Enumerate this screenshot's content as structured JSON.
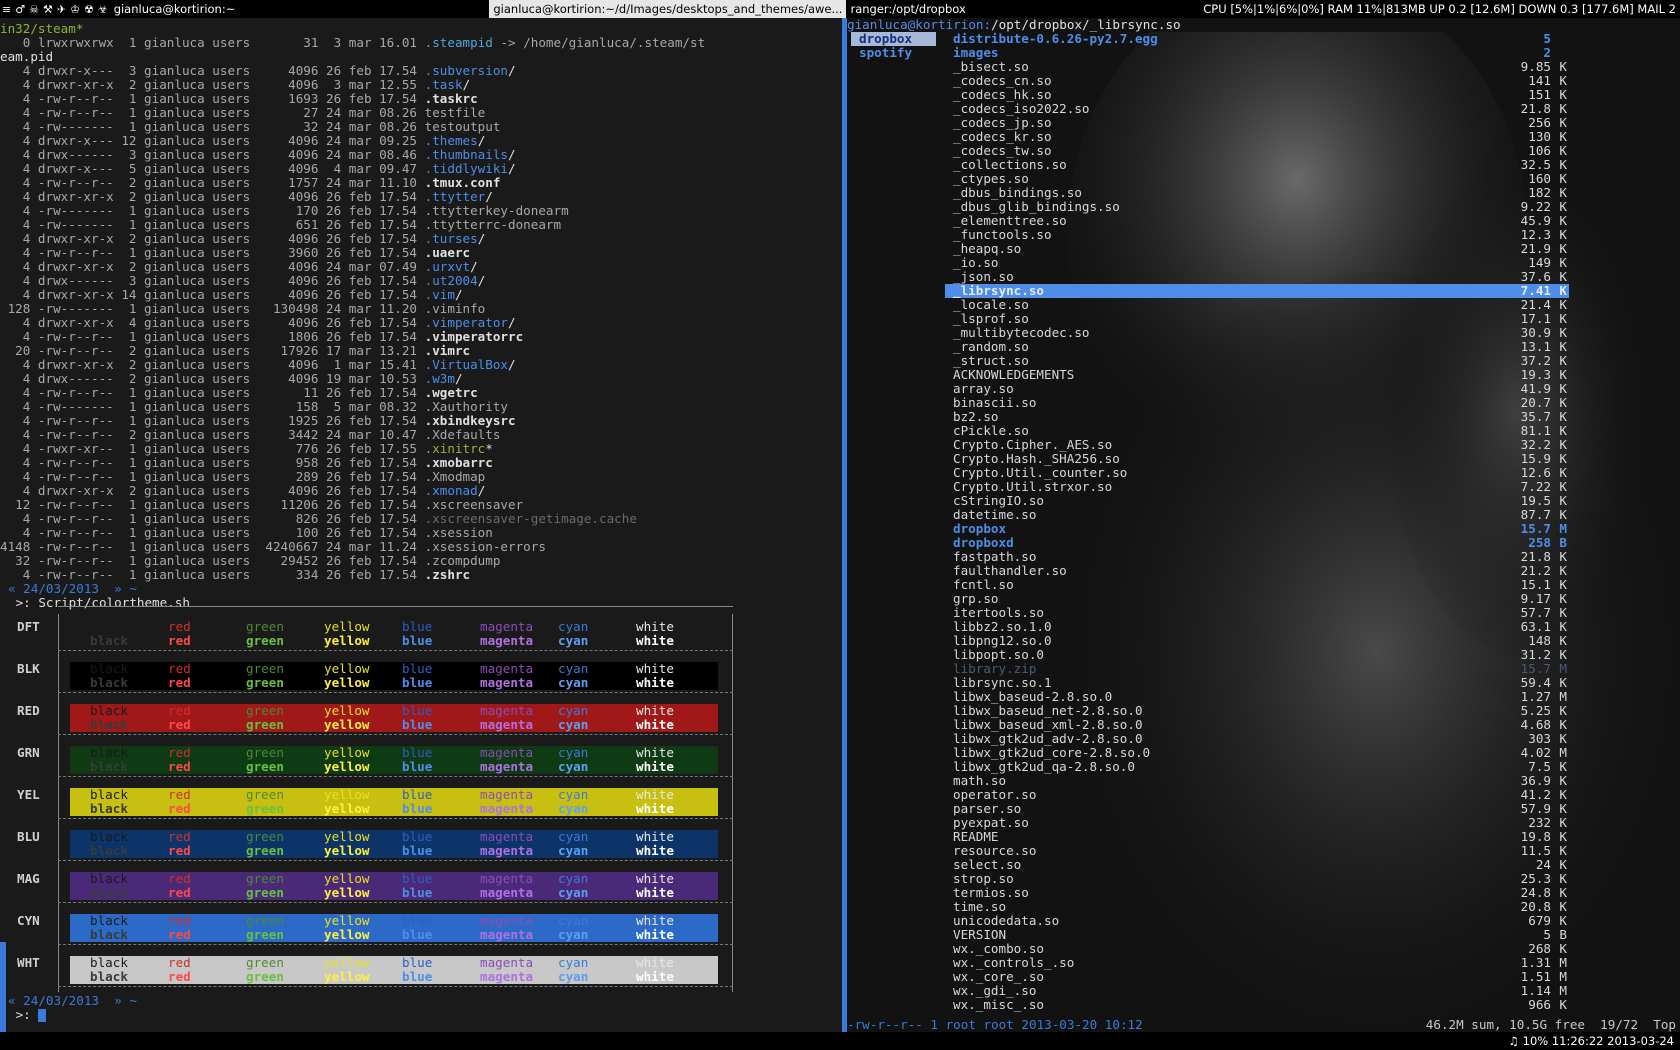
{
  "topbar": {
    "workspaces": [
      "≡",
      "♂",
      "☠",
      "⚒",
      "✈",
      "♔",
      "☢",
      "☣"
    ],
    "active_window": "gianluca@kortirion:~",
    "inactive_window": "gianluca@kortirion:~/d/Images/desktops_and_themes/awe...",
    "ranger_window": "ranger:/opt/dropbox",
    "status": "CPU [5%|1%|6%|0%] RAM 11%|813MB UP 0.2 [12.6M] DOWN 0.3 [177.6M] MAIL 2"
  },
  "bottombar": {
    "status": "♫ 10%  11:26:22 2013-03-24"
  },
  "left": {
    "head1": "in32/steam*",
    "steampid_line": "   0 lrwxrwxrwx  1 gianluca users       31  3 mar 16.01 ",
    "steampid_name": ".steampid",
    "steampid_target": " -> /home/gianluca/.steam/st",
    "steampid_wrap": "eam.pid",
    "ls": [
      {
        "meta": "   4 drwxr-x---  3 gianluca users     4096 26 feb 17.54 ",
        "name": ".subversion",
        "kind": "dir",
        "suffix": "/"
      },
      {
        "meta": "   4 drwxr-xr-x  2 gianluca users     4096  3 mar 12.55 ",
        "name": ".task",
        "kind": "dir",
        "suffix": "/"
      },
      {
        "meta": "   4 -rw-r--r--  1 gianluca users     1693 26 feb 17.54 ",
        "name": ".taskrc",
        "kind": "hl",
        "suffix": ""
      },
      {
        "meta": "   4 -rw-r--r--  1 gianluca users       27 24 mar 08.26 ",
        "name": "testfile",
        "kind": "plain",
        "suffix": ""
      },
      {
        "meta": "   4 -rw-------  1 gianluca users       32 24 mar 08.26 ",
        "name": "testoutput",
        "kind": "plain",
        "suffix": ""
      },
      {
        "meta": "   4 drwxr-x--- 12 gianluca users     4096 24 mar 09.25 ",
        "name": ".themes",
        "kind": "dir",
        "suffix": "/"
      },
      {
        "meta": "   4 drwx------  3 gianluca users     4096 24 mar 08.46 ",
        "name": ".thumbnails",
        "kind": "dir",
        "suffix": "/"
      },
      {
        "meta": "   4 drwxr-x---  5 gianluca users     4096  4 mar 09.47 ",
        "name": ".tiddlywiki",
        "kind": "dir",
        "suffix": "/"
      },
      {
        "meta": "   4 -rw-r--r--  2 gianluca users     1757 24 mar 11.10 ",
        "name": ".tmux.conf",
        "kind": "hl",
        "suffix": ""
      },
      {
        "meta": "   4 drwxr-xr-x  2 gianluca users     4096 26 feb 17.54 ",
        "name": ".ttytter",
        "kind": "dir",
        "suffix": "/"
      },
      {
        "meta": "   4 -rw-------  1 gianluca users      170 26 feb 17.54 ",
        "name": ".ttytterkey-donearm",
        "kind": "plain",
        "suffix": ""
      },
      {
        "meta": "   4 -rw-------  1 gianluca users      651 26 feb 17.54 ",
        "name": ".ttytterrc-donearm",
        "kind": "plain",
        "suffix": ""
      },
      {
        "meta": "   4 drwxr-xr-x  2 gianluca users     4096 26 feb 17.54 ",
        "name": ".turses",
        "kind": "dir",
        "suffix": "/"
      },
      {
        "meta": "   4 -rw-r--r--  1 gianluca users     3960 26 feb 17.54 ",
        "name": ".uaerc",
        "kind": "hl",
        "suffix": ""
      },
      {
        "meta": "   4 drwxr-xr-x  2 gianluca users     4096 24 mar 07.49 ",
        "name": ".urxvt",
        "kind": "dir",
        "suffix": "/"
      },
      {
        "meta": "   4 drwx------  3 gianluca users     4096 26 feb 17.54 ",
        "name": ".ut2004",
        "kind": "dir",
        "suffix": "/"
      },
      {
        "meta": "   4 drwxr-xr-x 14 gianluca users     4096 26 feb 17.54 ",
        "name": ".vim",
        "kind": "dir",
        "suffix": "/"
      },
      {
        "meta": " 128 -rw-------  1 gianluca users   130498 24 mar 11.20 ",
        "name": ".viminfo",
        "kind": "plain",
        "suffix": ""
      },
      {
        "meta": "   4 drwxr-xr-x  4 gianluca users     4096 26 feb 17.54 ",
        "name": ".vimperator",
        "kind": "dir",
        "suffix": "/"
      },
      {
        "meta": "   4 -rw-r--r--  1 gianluca users     1806 26 feb 17.54 ",
        "name": ".vimperatorrc",
        "kind": "hl",
        "suffix": ""
      },
      {
        "meta": "  20 -rw-r--r--  2 gianluca users    17926 17 mar 13.21 ",
        "name": ".vimrc",
        "kind": "hl",
        "suffix": ""
      },
      {
        "meta": "   4 drwxr-xr-x  2 gianluca users     4096  1 mar 15.41 ",
        "name": ".VirtualBox",
        "kind": "dir",
        "suffix": "/"
      },
      {
        "meta": "   4 drwx------  2 gianluca users     4096 19 mar 10.53 ",
        "name": ".w3m",
        "kind": "dir",
        "suffix": "/"
      },
      {
        "meta": "   4 -rw-r--r--  1 gianluca users       11 26 feb 17.54 ",
        "name": ".wgetrc",
        "kind": "hl",
        "suffix": ""
      },
      {
        "meta": "   4 -rw-------  1 gianluca users      158  5 mar 08.32 ",
        "name": ".Xauthority",
        "kind": "plain",
        "suffix": ""
      },
      {
        "meta": "   4 -rw-r--r--  1 gianluca users     1925 26 feb 17.54 ",
        "name": ".xbindkeysrc",
        "kind": "hl",
        "suffix": ""
      },
      {
        "meta": "   4 -rw-r--r--  2 gianluca users     3442 24 mar 10.47 ",
        "name": ".Xdefaults",
        "kind": "plain",
        "suffix": ""
      },
      {
        "meta": "   4 -rwxr-xr--  1 gianluca users      776 26 feb 17.55 ",
        "name": ".xinitrc",
        "kind": "exe",
        "suffix": "*"
      },
      {
        "meta": "   4 -rw-r--r--  1 gianluca users      958 26 feb 17.54 ",
        "name": ".xmobarrc",
        "kind": "hl",
        "suffix": ""
      },
      {
        "meta": "   4 -rw-r--r--  1 gianluca users      289 26 feb 17.54 ",
        "name": ".Xmodmap",
        "kind": "plain",
        "suffix": ""
      },
      {
        "meta": "   4 drwxr-xr-x  2 gianluca users     4096 26 feb 17.54 ",
        "name": ".xmonad",
        "kind": "dir",
        "suffix": "/"
      },
      {
        "meta": "  12 -rw-r--r--  1 gianluca users    11206 26 feb 17.54 ",
        "name": ".xscreensaver",
        "kind": "plain",
        "suffix": ""
      },
      {
        "meta": "   4 -rw-r--r--  1 gianluca users      826 26 feb 17.54 ",
        "name": ".xscreensaver-getimage.cache",
        "kind": "dim",
        "suffix": ""
      },
      {
        "meta": "   4 -rw-r--r--  1 gianluca users      100 26 feb 17.54 ",
        "name": ".xsession",
        "kind": "plain",
        "suffix": ""
      },
      {
        "meta": "4148 -rw-r--r--  1 gianluca users  4240667 24 mar 11.24 ",
        "name": ".xsession-errors",
        "kind": "plain",
        "suffix": ""
      },
      {
        "meta": "  32 -rw-r--r--  1 gianluca users    29452 26 feb 17.54 ",
        "name": ".zcompdump",
        "kind": "plain",
        "suffix": ""
      },
      {
        "meta": "   4 -rw-r--r--  1 gianluca users      334 26 feb 17.54 ",
        "name": ".zshrc",
        "kind": "hl",
        "suffix": ""
      }
    ],
    "prompt1_date": "« 24/03/2013  » ~",
    "prompt1_cmd": " >: Script/colortheme.sh",
    "prompt2_date": "« 24/03/2013  » ~",
    "prompt2_cmd": " >: ",
    "colortheme": {
      "rows": [
        "DFT",
        "BLK",
        "RED",
        "GRN",
        "YEL",
        "BLU",
        "MAG",
        "CYN",
        "WHT"
      ],
      "names": [
        "black",
        "red",
        "green",
        "yellow",
        "blue",
        "magenta",
        "cyan",
        "white"
      ]
    }
  },
  "right": {
    "path_user": "gianluca@kortirion:",
    "path": "/opt/dropbox/_librsync.so",
    "col1": [
      "dropbox",
      "spotify"
    ],
    "files": [
      {
        "n": "distribute-0.6.26-py2.7.egg",
        "s": "5",
        "u": "",
        "k": "dir"
      },
      {
        "n": "images",
        "s": "2",
        "u": "",
        "k": "dir"
      },
      {
        "n": "_bisect.so",
        "s": "9.85",
        "u": "K",
        "k": "f"
      },
      {
        "n": "_codecs_cn.so",
        "s": "141",
        "u": "K",
        "k": "f"
      },
      {
        "n": "_codecs_hk.so",
        "s": "151",
        "u": "K",
        "k": "f"
      },
      {
        "n": "_codecs_iso2022.so",
        "s": "21.8",
        "u": "K",
        "k": "f"
      },
      {
        "n": "_codecs_jp.so",
        "s": "256",
        "u": "K",
        "k": "f"
      },
      {
        "n": "_codecs_kr.so",
        "s": "130",
        "u": "K",
        "k": "f"
      },
      {
        "n": "_codecs_tw.so",
        "s": "106",
        "u": "K",
        "k": "f"
      },
      {
        "n": "_collections.so",
        "s": "32.5",
        "u": "K",
        "k": "f"
      },
      {
        "n": "_ctypes.so",
        "s": "160",
        "u": "K",
        "k": "f"
      },
      {
        "n": "_dbus_bindings.so",
        "s": "182",
        "u": "K",
        "k": "f"
      },
      {
        "n": "_dbus_glib_bindings.so",
        "s": "9.22",
        "u": "K",
        "k": "f"
      },
      {
        "n": "_elementtree.so",
        "s": "45.9",
        "u": "K",
        "k": "f"
      },
      {
        "n": "_functools.so",
        "s": "12.3",
        "u": "K",
        "k": "f"
      },
      {
        "n": "_heapq.so",
        "s": "21.9",
        "u": "K",
        "k": "f"
      },
      {
        "n": "_io.so",
        "s": "149",
        "u": "K",
        "k": "f"
      },
      {
        "n": "_json.so",
        "s": "37.6",
        "u": "K",
        "k": "f"
      },
      {
        "n": "_librsync.so",
        "s": "7.41",
        "u": "K",
        "k": "sel"
      },
      {
        "n": "_locale.so",
        "s": "21.4",
        "u": "K",
        "k": "f"
      },
      {
        "n": "_lsprof.so",
        "s": "17.1",
        "u": "K",
        "k": "f"
      },
      {
        "n": "_multibytecodec.so",
        "s": "30.9",
        "u": "K",
        "k": "f"
      },
      {
        "n": "_random.so",
        "s": "13.1",
        "u": "K",
        "k": "f"
      },
      {
        "n": "_struct.so",
        "s": "37.2",
        "u": "K",
        "k": "f"
      },
      {
        "n": "ACKNOWLEDGEMENTS",
        "s": "19.3",
        "u": "K",
        "k": "f"
      },
      {
        "n": "array.so",
        "s": "41.9",
        "u": "K",
        "k": "f"
      },
      {
        "n": "binascii.so",
        "s": "20.7",
        "u": "K",
        "k": "f"
      },
      {
        "n": "bz2.so",
        "s": "35.7",
        "u": "K",
        "k": "f"
      },
      {
        "n": "cPickle.so",
        "s": "81.1",
        "u": "K",
        "k": "f"
      },
      {
        "n": "Crypto.Cipher._AES.so",
        "s": "32.2",
        "u": "K",
        "k": "f"
      },
      {
        "n": "Crypto.Hash._SHA256.so",
        "s": "15.9",
        "u": "K",
        "k": "f"
      },
      {
        "n": "Crypto.Util._counter.so",
        "s": "12.6",
        "u": "K",
        "k": "f"
      },
      {
        "n": "Crypto.Util.strxor.so",
        "s": "7.22",
        "u": "K",
        "k": "f"
      },
      {
        "n": "cStringIO.so",
        "s": "19.5",
        "u": "K",
        "k": "f"
      },
      {
        "n": "datetime.so",
        "s": "87.7",
        "u": "K",
        "k": "f"
      },
      {
        "n": "dropbox",
        "s": "15.7",
        "u": "M",
        "k": "dir"
      },
      {
        "n": "dropboxd",
        "s": "258",
        "u": "B",
        "k": "dir"
      },
      {
        "n": "fastpath.so",
        "s": "21.8",
        "u": "K",
        "k": "f"
      },
      {
        "n": "faulthandler.so",
        "s": "21.2",
        "u": "K",
        "k": "f"
      },
      {
        "n": "fcntl.so",
        "s": "15.1",
        "u": "K",
        "k": "f"
      },
      {
        "n": "grp.so",
        "s": "9.17",
        "u": "K",
        "k": "f"
      },
      {
        "n": "itertools.so",
        "s": "57.7",
        "u": "K",
        "k": "f"
      },
      {
        "n": "libbz2.so.1.0",
        "s": "63.1",
        "u": "K",
        "k": "f"
      },
      {
        "n": "libpng12.so.0",
        "s": "148",
        "u": "K",
        "k": "f"
      },
      {
        "n": "libpopt.so.0",
        "s": "31.2",
        "u": "K",
        "k": "f"
      },
      {
        "n": "library.zip",
        "s": "15.7",
        "u": "M",
        "k": "dim"
      },
      {
        "n": "librsync.so.1",
        "s": "59.4",
        "u": "K",
        "k": "f"
      },
      {
        "n": "libwx_baseud-2.8.so.0",
        "s": "1.27",
        "u": "M",
        "k": "f"
      },
      {
        "n": "libwx_baseud_net-2.8.so.0",
        "s": "5.25",
        "u": "K",
        "k": "f"
      },
      {
        "n": "libwx_baseud_xml-2.8.so.0",
        "s": "4.68",
        "u": "K",
        "k": "f"
      },
      {
        "n": "libwx_gtk2ud_adv-2.8.so.0",
        "s": "303",
        "u": "K",
        "k": "f"
      },
      {
        "n": "libwx_gtk2ud_core-2.8.so.0",
        "s": "4.02",
        "u": "M",
        "k": "f"
      },
      {
        "n": "libwx_gtk2ud_qa-2.8.so.0",
        "s": "7.5",
        "u": "K",
        "k": "f"
      },
      {
        "n": "math.so",
        "s": "36.9",
        "u": "K",
        "k": "f"
      },
      {
        "n": "operator.so",
        "s": "41.2",
        "u": "K",
        "k": "f"
      },
      {
        "n": "parser.so",
        "s": "57.9",
        "u": "K",
        "k": "f"
      },
      {
        "n": "pyexpat.so",
        "s": "232",
        "u": "K",
        "k": "f"
      },
      {
        "n": "README",
        "s": "19.8",
        "u": "K",
        "k": "f"
      },
      {
        "n": "resource.so",
        "s": "11.5",
        "u": "K",
        "k": "f"
      },
      {
        "n": "select.so",
        "s": "24",
        "u": "K",
        "k": "f"
      },
      {
        "n": "strop.so",
        "s": "25.3",
        "u": "K",
        "k": "f"
      },
      {
        "n": "termios.so",
        "s": "24.8",
        "u": "K",
        "k": "f"
      },
      {
        "n": "time.so",
        "s": "20.8",
        "u": "K",
        "k": "f"
      },
      {
        "n": "unicodedata.so",
        "s": "679",
        "u": "K",
        "k": "f"
      },
      {
        "n": "VERSION",
        "s": "5",
        "u": "B",
        "k": "f"
      },
      {
        "n": "wx._combo.so",
        "s": "268",
        "u": "K",
        "k": "f"
      },
      {
        "n": "wx._controls_.so",
        "s": "1.31",
        "u": "M",
        "k": "f"
      },
      {
        "n": "wx._core_.so",
        "s": "1.51",
        "u": "M",
        "k": "f"
      },
      {
        "n": "wx._gdi_.so",
        "s": "1.14",
        "u": "M",
        "k": "f"
      },
      {
        "n": "wx._misc_.so",
        "s": "966",
        "u": "K",
        "k": "f"
      }
    ],
    "bottom_left": "-rw-r--r-- 1 root root 2013-03-20 10:12",
    "bottom_right": "46.2M sum, 10.5G free  19/72  Top"
  },
  "colors": {
    "accent": "#3a7ad9",
    "dir": "#4c8ee8",
    "exe": "#8db43a"
  }
}
